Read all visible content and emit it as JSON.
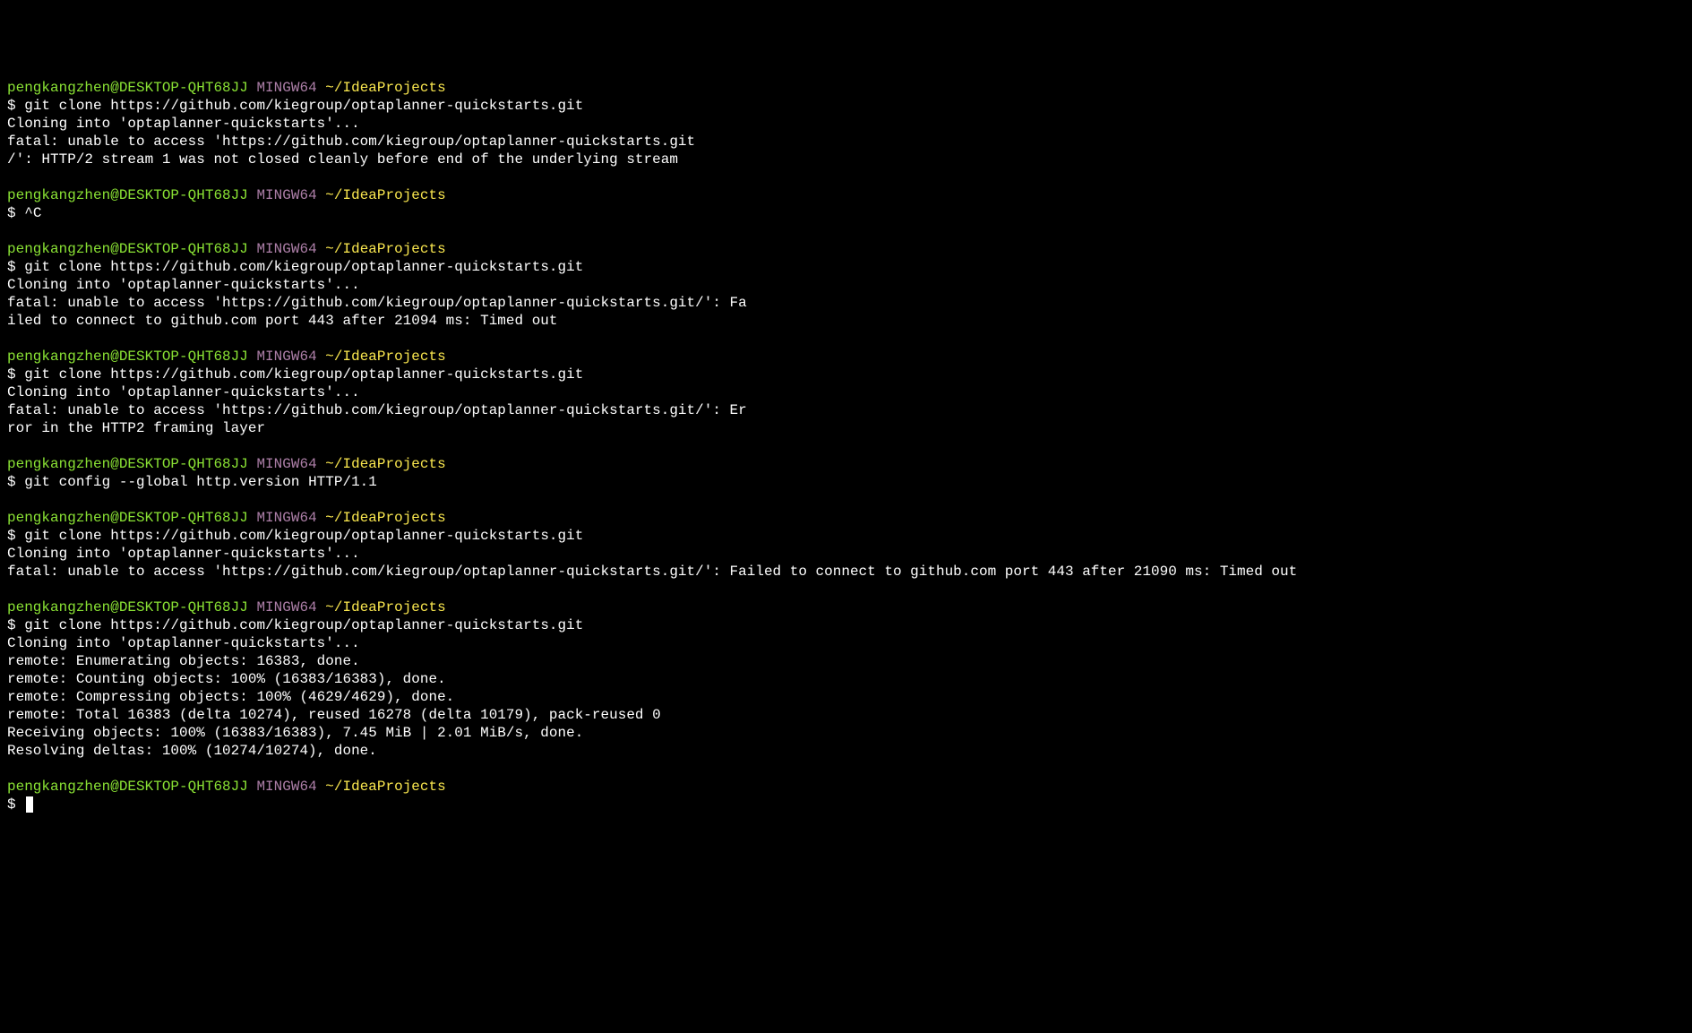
{
  "prompt": {
    "user_host": "pengkangzhen@DESKTOP-QHT68JJ",
    "mingw": "MINGW64",
    "path": "~/IdeaProjects",
    "symbol": "$"
  },
  "blocks": [
    {
      "command": "git clone https://github.com/kiegroup/optaplanner-quickstarts.git",
      "output": [
        "Cloning into 'optaplanner-quickstarts'...",
        "fatal: unable to access 'https://github.com/kiegroup/optaplanner-quickstarts.git",
        "/': HTTP/2 stream 1 was not closed cleanly before end of the underlying stream"
      ]
    },
    {
      "command": "^C",
      "output": []
    },
    {
      "command": "git clone https://github.com/kiegroup/optaplanner-quickstarts.git",
      "output": [
        "Cloning into 'optaplanner-quickstarts'...",
        "fatal: unable to access 'https://github.com/kiegroup/optaplanner-quickstarts.git/': Fa",
        "iled to connect to github.com port 443 after 21094 ms: Timed out"
      ]
    },
    {
      "command": "git clone https://github.com/kiegroup/optaplanner-quickstarts.git",
      "output": [
        "Cloning into 'optaplanner-quickstarts'...",
        "fatal: unable to access 'https://github.com/kiegroup/optaplanner-quickstarts.git/': Er",
        "ror in the HTTP2 framing layer"
      ]
    },
    {
      "command": "git config --global http.version HTTP/1.1",
      "output": []
    },
    {
      "command": "git clone https://github.com/kiegroup/optaplanner-quickstarts.git",
      "output": [
        "Cloning into 'optaplanner-quickstarts'...",
        "fatal: unable to access 'https://github.com/kiegroup/optaplanner-quickstarts.git/': Failed to connect to github.com port 443 after 21090 ms: Timed out"
      ]
    },
    {
      "command": "git clone https://github.com/kiegroup/optaplanner-quickstarts.git",
      "output": [
        "Cloning into 'optaplanner-quickstarts'...",
        "remote: Enumerating objects: 16383, done.",
        "remote: Counting objects: 100% (16383/16383), done.",
        "remote: Compressing objects: 100% (4629/4629), done.",
        "remote: Total 16383 (delta 10274), reused 16278 (delta 10179), pack-reused 0",
        "Receiving objects: 100% (16383/16383), 7.45 MiB | 2.01 MiB/s, done.",
        "Resolving deltas: 100% (10274/10274), done."
      ]
    }
  ]
}
